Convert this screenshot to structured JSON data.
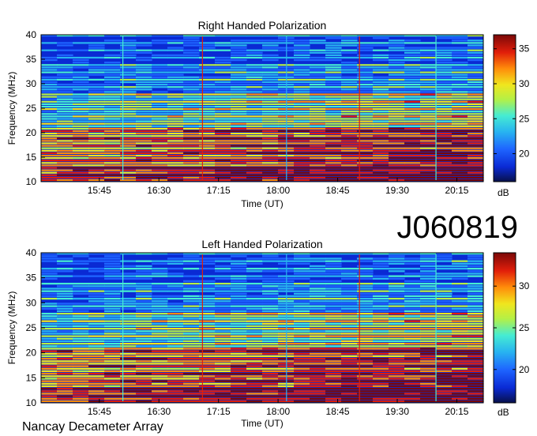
{
  "page": {
    "observation_id": "J060819",
    "footer": "Nancay Decameter Array"
  },
  "colors": {
    "scale": [
      "#08104a",
      "#0a2ad4",
      "#1e64ff",
      "#28b4f0",
      "#46ecd2",
      "#b4f046",
      "#f0e61e",
      "#ff8c0a",
      "#e11e0a",
      "#7a0808"
    ]
  },
  "chart_data": [
    {
      "type": "heatmap",
      "title": "Right Handed Polarization",
      "xlabel": "Time (UT)",
      "ylabel": "Frequency (MHz)",
      "x_ticks": [
        "15:45",
        "16:30",
        "17:15",
        "18:00",
        "18:45",
        "19:30",
        "20:15"
      ],
      "y_ticks": [
        10,
        15,
        20,
        25,
        30,
        35,
        40
      ],
      "ylim": [
        10,
        40
      ],
      "colorbar": {
        "label": "dB",
        "ticks": [
          20,
          25,
          30,
          35
        ],
        "range": [
          16,
          37
        ]
      }
    },
    {
      "type": "heatmap",
      "title": "Left Handed Polarization",
      "xlabel": "Time (UT)",
      "ylabel": "Frequency (MHz)",
      "x_ticks": [
        "15:45",
        "16:30",
        "17:15",
        "18:00",
        "18:45",
        "19:30",
        "20:15"
      ],
      "y_ticks": [
        10,
        15,
        20,
        25,
        30,
        35,
        40
      ],
      "ylim": [
        10,
        40
      ],
      "colorbar": {
        "label": "dB",
        "ticks": [
          20,
          25,
          30
        ],
        "range": [
          16,
          34
        ]
      }
    }
  ]
}
